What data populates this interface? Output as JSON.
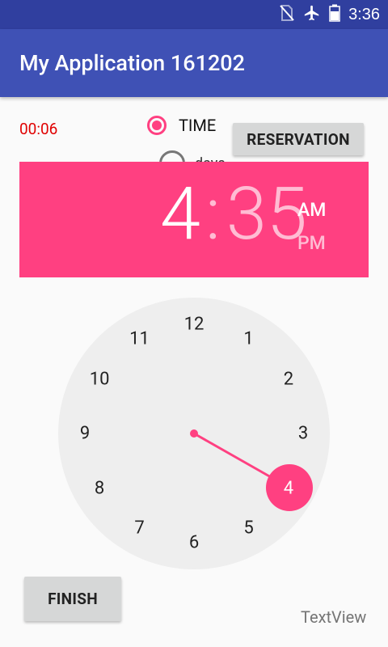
{
  "status_bar": {
    "time": "3:36",
    "icons": [
      "no-sim-icon",
      "airplane-icon",
      "battery-icon"
    ]
  },
  "app_bar": {
    "title": "My Application 161202"
  },
  "timer": "00:06",
  "radio_group": {
    "time_label": "TIME",
    "time_selected": true,
    "days_label": "days",
    "days_selected": false
  },
  "buttons": {
    "reservation": "RESERVATION",
    "finish": "FINISH"
  },
  "time_picker": {
    "hour": "4",
    "separator": ":",
    "minute": "35",
    "am": "AM",
    "pm": "PM",
    "am_selected": true,
    "accent_color": "#ff4081",
    "clock_numbers": [
      "12",
      "1",
      "2",
      "3",
      "4",
      "5",
      "6",
      "7",
      "8",
      "9",
      "10",
      "11"
    ],
    "selected_hour": "4"
  },
  "textview": "TextView",
  "colors": {
    "primary": "#3f51b5",
    "primary_dark": "#303f9f",
    "accent": "#ff4081",
    "timer": "#e00000"
  }
}
